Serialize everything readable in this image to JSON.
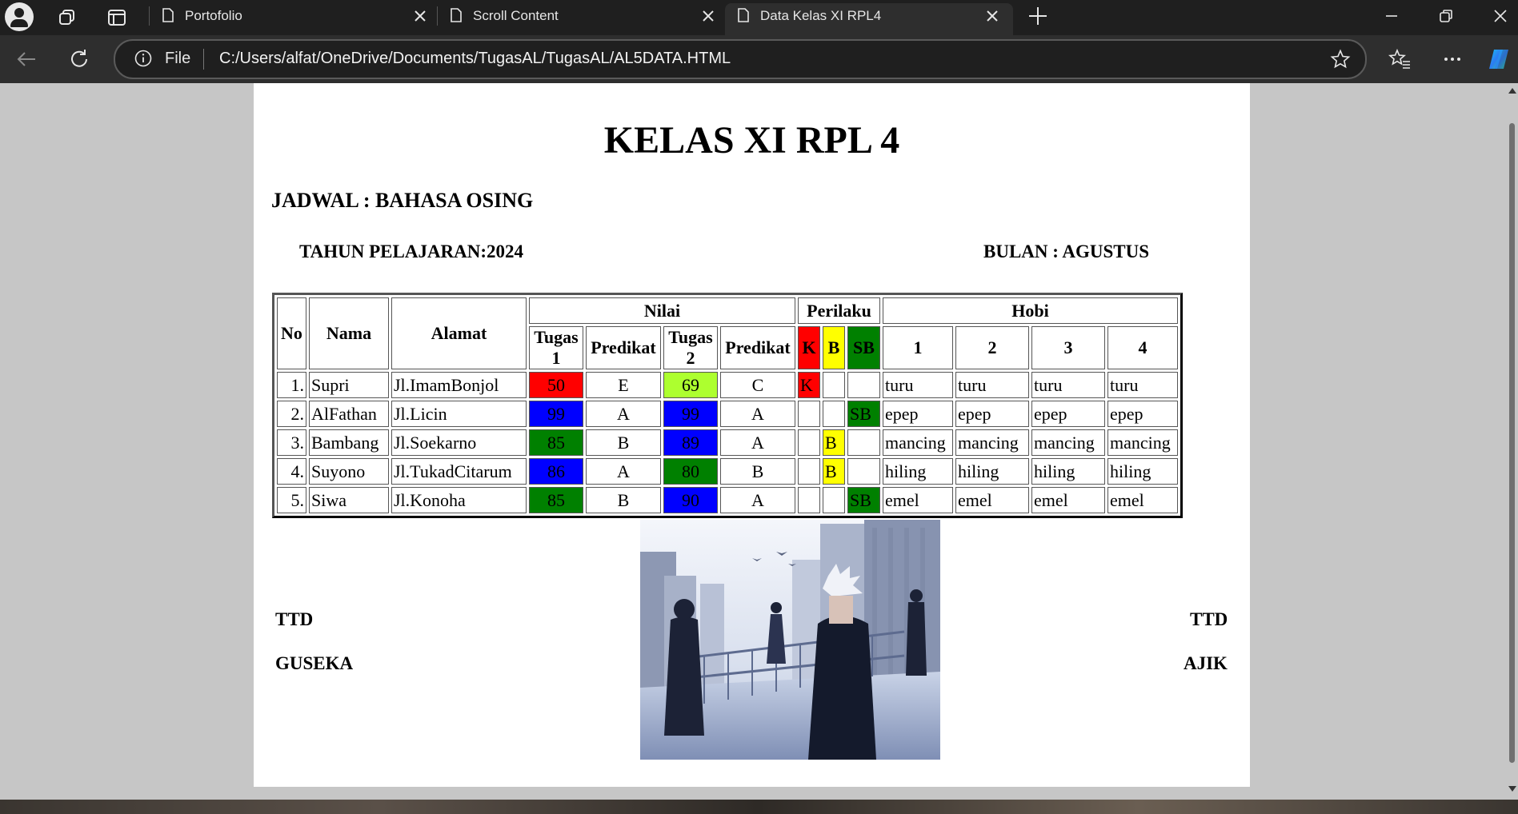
{
  "browser": {
    "tabs": [
      {
        "title": "Portofolio",
        "active": false
      },
      {
        "title": "Scroll Content",
        "active": false
      },
      {
        "title": "Data Kelas XI RPL4",
        "active": true
      }
    ],
    "address": {
      "scheme": "File",
      "url": "C:/Users/alfat/OneDrive/Documents/TugasAL/TugasAL/AL5DATA.HTML"
    },
    "icons": {
      "profile": "profile-icon",
      "workspaces": "workspaces-icon",
      "tab_actions": "vertical-tabs-icon",
      "new_tab": "plus-icon",
      "back": "back-arrow-icon",
      "refresh": "refresh-icon",
      "info": "info-icon",
      "favorite": "star-icon",
      "favorites": "favorites-icon",
      "menu": "more-icon",
      "copilot": "copilot-icon"
    }
  },
  "page": {
    "title": "KELAS XI RPL 4",
    "jadwal": "JADWAL : BAHASA OSING",
    "tahun": "TAHUN PELAJARAN:2024",
    "bulan": "BULAN : AGUSTUS",
    "table": {
      "headers": {
        "no": "No",
        "nama": "Nama",
        "alamat": "Alamat",
        "nilai": "Nilai",
        "perilaku": "Perilaku",
        "hobi": "Hobi",
        "tugas1": "Tugas 1",
        "predikat1": "Predikat",
        "tugas2": "Tugas 2",
        "predikat2": "Predikat",
        "k": "K",
        "b": "B",
        "sb": "SB",
        "h1": "1",
        "h2": "2",
        "h3": "3",
        "h4": "4"
      },
      "header_colors": {
        "k": "#ff0000",
        "b": "#ffff00",
        "sb": "#008000"
      },
      "rows": [
        {
          "no": "1.",
          "nama": "Supri",
          "alamat": "Jl.ImamBonjol",
          "tugas1": "50",
          "tugas1_color": "#ff0000",
          "pred1": "E",
          "tugas2": "69",
          "tugas2_color": "#adff2f",
          "pred2": "C",
          "k": "K",
          "b": "",
          "sb": "",
          "hobi": [
            "turu",
            "turu",
            "turu",
            "turu"
          ]
        },
        {
          "no": "2.",
          "nama": "AlFathan",
          "alamat": "Jl.Licin",
          "tugas1": "99",
          "tugas1_color": "#0000ff",
          "pred1": "A",
          "tugas2": "99",
          "tugas2_color": "#0000ff",
          "pred2": "A",
          "k": "",
          "b": "",
          "sb": "SB",
          "hobi": [
            "epep",
            "epep",
            "epep",
            "epep"
          ]
        },
        {
          "no": "3.",
          "nama": "Bambang",
          "alamat": "Jl.Soekarno",
          "tugas1": "85",
          "tugas1_color": "#008000",
          "pred1": "B",
          "tugas2": "89",
          "tugas2_color": "#0000ff",
          "pred2": "A",
          "k": "",
          "b": "B",
          "sb": "",
          "hobi": [
            "mancing",
            "mancing",
            "mancing",
            "mancing"
          ]
        },
        {
          "no": "4.",
          "nama": "Suyono",
          "alamat": "Jl.TukadCitarum",
          "tugas1": "86",
          "tugas1_color": "#0000ff",
          "pred1": "A",
          "tugas2": "80",
          "tugas2_color": "#008000",
          "pred2": "B",
          "k": "",
          "b": "B",
          "sb": "",
          "hobi": [
            "hiling",
            "hiling",
            "hiling",
            "hiling"
          ]
        },
        {
          "no": "5.",
          "nama": "Siwa",
          "alamat": "Jl.Konoha",
          "tugas1": "85",
          "tugas1_color": "#008000",
          "pred1": "B",
          "tugas2": "90",
          "tugas2_color": "#0000ff",
          "pred2": "A",
          "k": "",
          "b": "",
          "sb": "SB",
          "hobi": [
            "emel",
            "emel",
            "emel",
            "emel"
          ]
        }
      ]
    },
    "signatures": {
      "left_label": "TTD",
      "left_name": "GUSEKA",
      "right_label": "TTD",
      "right_name": "AJIK"
    }
  }
}
